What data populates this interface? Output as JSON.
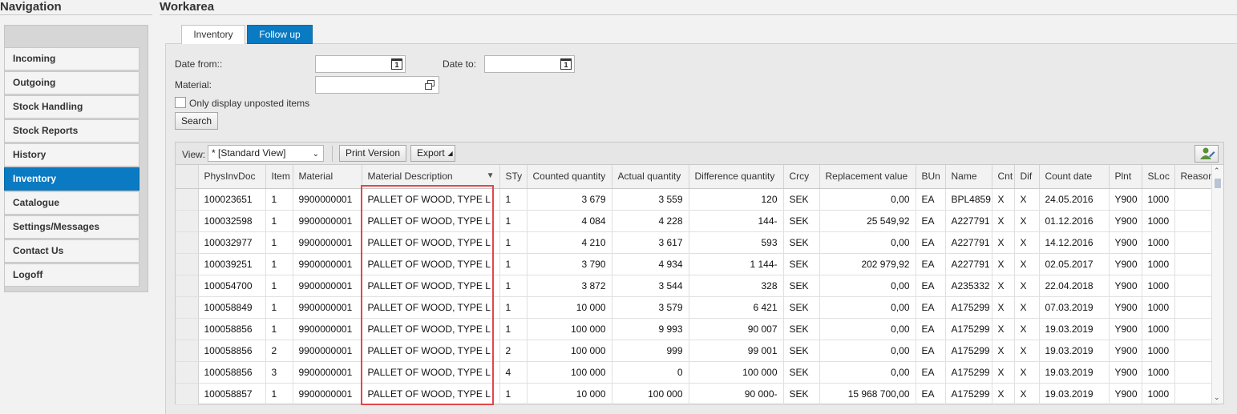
{
  "nav": {
    "title": "Navigation",
    "items": [
      {
        "label": "Incoming"
      },
      {
        "label": "Outgoing"
      },
      {
        "label": "Stock Handling"
      },
      {
        "label": "Stock Reports"
      },
      {
        "label": "History"
      },
      {
        "label": "Inventory",
        "active": true
      },
      {
        "label": "Catalogue"
      },
      {
        "label": "Settings/Messages"
      },
      {
        "label": "Contact Us"
      },
      {
        "label": "Logoff"
      }
    ]
  },
  "work": {
    "title": "Workarea",
    "tabs": [
      {
        "label": "Inventory",
        "active": false
      },
      {
        "label": "Follow up",
        "active": true
      }
    ]
  },
  "form": {
    "date_from_label": "Date from::",
    "date_from_value": "",
    "date_to_label": "Date to:",
    "date_to_value": "",
    "material_label": "Material:",
    "material_value": "",
    "only_unposted_label": "Only display unposted items",
    "only_unposted_checked": false,
    "search_label": "Search",
    "calendar_glyph": "1"
  },
  "toolbar": {
    "view_label": "View:",
    "view_value": "* [Standard View]",
    "print_label": "Print Version",
    "export_label": "Export"
  },
  "table": {
    "columns": [
      "PhysInvDoc",
      "Item",
      "Material",
      "Material Description",
      "STy",
      "Counted quantity",
      "Actual quantity",
      "Difference quantity",
      "Crcy",
      "Replacement value",
      "BUn",
      "Name",
      "Cnt",
      "Dif",
      "Count date",
      "Plnt",
      "SLoc",
      "Reason"
    ],
    "rows": [
      [
        "100023651",
        "1",
        "9900000001",
        "PALLET OF WOOD, TYPE L",
        "1",
        "3 679",
        "3 559",
        "120",
        "SEK",
        "0,00",
        "EA",
        "BPL4859",
        "X",
        "X",
        "24.05.2016",
        "Y900",
        "1000",
        ""
      ],
      [
        "100032598",
        "1",
        "9900000001",
        "PALLET OF WOOD, TYPE L",
        "1",
        "4 084",
        "4 228",
        "144-",
        "SEK",
        "25 549,92",
        "EA",
        "A227791",
        "X",
        "X",
        "01.12.2016",
        "Y900",
        "1000",
        ""
      ],
      [
        "100032977",
        "1",
        "9900000001",
        "PALLET OF WOOD, TYPE L",
        "1",
        "4 210",
        "3 617",
        "593",
        "SEK",
        "0,00",
        "EA",
        "A227791",
        "X",
        "X",
        "14.12.2016",
        "Y900",
        "1000",
        ""
      ],
      [
        "100039251",
        "1",
        "9900000001",
        "PALLET OF WOOD, TYPE L",
        "1",
        "3 790",
        "4 934",
        "1 144-",
        "SEK",
        "202 979,92",
        "EA",
        "A227791",
        "X",
        "X",
        "02.05.2017",
        "Y900",
        "1000",
        ""
      ],
      [
        "100054700",
        "1",
        "9900000001",
        "PALLET OF WOOD, TYPE L",
        "1",
        "3 872",
        "3 544",
        "328",
        "SEK",
        "0,00",
        "EA",
        "A235332",
        "X",
        "X",
        "22.04.2018",
        "Y900",
        "1000",
        ""
      ],
      [
        "100058849",
        "1",
        "9900000001",
        "PALLET OF WOOD, TYPE L",
        "1",
        "10 000",
        "3 579",
        "6 421",
        "SEK",
        "0,00",
        "EA",
        "A175299",
        "X",
        "X",
        "07.03.2019",
        "Y900",
        "1000",
        ""
      ],
      [
        "100058856",
        "1",
        "9900000001",
        "PALLET OF WOOD, TYPE L",
        "1",
        "100 000",
        "9 993",
        "90 007",
        "SEK",
        "0,00",
        "EA",
        "A175299",
        "X",
        "X",
        "19.03.2019",
        "Y900",
        "1000",
        ""
      ],
      [
        "100058856",
        "2",
        "9900000001",
        "PALLET OF WOOD, TYPE L",
        "2",
        "100 000",
        "999",
        "99 001",
        "SEK",
        "0,00",
        "EA",
        "A175299",
        "X",
        "X",
        "19.03.2019",
        "Y900",
        "1000",
        ""
      ],
      [
        "100058856",
        "3",
        "9900000001",
        "PALLET OF WOOD, TYPE L",
        "4",
        "100 000",
        "0",
        "100 000",
        "SEK",
        "0,00",
        "EA",
        "A175299",
        "X",
        "X",
        "19.03.2019",
        "Y900",
        "1000",
        ""
      ],
      [
        "100058857",
        "1",
        "9900000001",
        "PALLET OF WOOD, TYPE L",
        "1",
        "10 000",
        "100 000",
        "90 000-",
        "SEK",
        "15 968 700,00",
        "EA",
        "A175299",
        "X",
        "X",
        "19.03.2019",
        "Y900",
        "1000",
        ""
      ]
    ]
  },
  "colors": {
    "accent": "#0a7ac2",
    "highlight": "#e2474b"
  }
}
